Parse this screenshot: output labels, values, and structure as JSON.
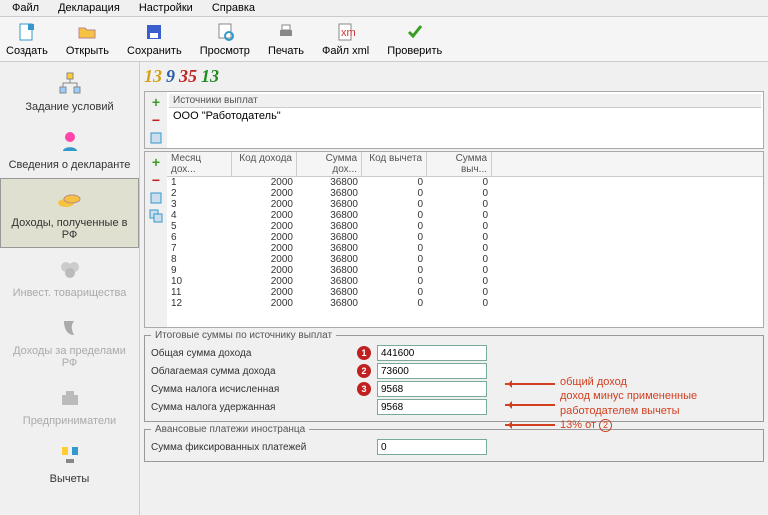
{
  "menu": {
    "file": "Файл",
    "decl": "Декларация",
    "settings": "Настройки",
    "help": "Справка"
  },
  "toolbar": {
    "create": "Создать",
    "open": "Открыть",
    "save": "Сохранить",
    "preview": "Просмотр",
    "print": "Печать",
    "xml": "Файл xml",
    "check": "Проверить"
  },
  "sidebar": {
    "conditions": "Задание условий",
    "declarant": "Сведения о декларанте",
    "income_rf": "Доходы, полученные в РФ",
    "invest": "Инвест. товарищества",
    "income_abroad": "Доходы за пределами РФ",
    "entrepreneurs": "Предприниматели",
    "deductions": "Вычеты"
  },
  "tabs": {
    "t1": "13",
    "t2": "9",
    "t3": "35",
    "t4": "13"
  },
  "sources": {
    "title": "Источники выплат",
    "item1": "ООО \"Работодатель\""
  },
  "grid": {
    "headers": [
      "Месяц дох...",
      "Код дохода",
      "Сумма дох...",
      "Код вычета",
      "Сумма выч..."
    ],
    "rows": [
      [
        "1",
        "2000",
        "36800",
        "0",
        "0"
      ],
      [
        "2",
        "2000",
        "36800",
        "0",
        "0"
      ],
      [
        "3",
        "2000",
        "36800",
        "0",
        "0"
      ],
      [
        "4",
        "2000",
        "36800",
        "0",
        "0"
      ],
      [
        "5",
        "2000",
        "36800",
        "0",
        "0"
      ],
      [
        "6",
        "2000",
        "36800",
        "0",
        "0"
      ],
      [
        "7",
        "2000",
        "36800",
        "0",
        "0"
      ],
      [
        "8",
        "2000",
        "36800",
        "0",
        "0"
      ],
      [
        "9",
        "2000",
        "36800",
        "0",
        "0"
      ],
      [
        "10",
        "2000",
        "36800",
        "0",
        "0"
      ],
      [
        "11",
        "2000",
        "36800",
        "0",
        "0"
      ],
      [
        "12",
        "2000",
        "36800",
        "0",
        "0"
      ]
    ]
  },
  "totals": {
    "legend": "Итоговые суммы по источнику выплат",
    "total_income_label": "Общая сумма дохода",
    "total_income": "441600",
    "taxable_label": "Облагаемая сумма дохода",
    "taxable": "73600",
    "tax_calc_label": "Сумма налога исчисленная",
    "tax_calc": "9568",
    "tax_withheld_label": "Сумма налога удержанная",
    "tax_withheld": "9568",
    "b1": "1",
    "b2": "2",
    "b3": "3"
  },
  "advance": {
    "legend": "Авансовые платежи иностранца",
    "fixed_label": "Сумма фиксированных платежей",
    "fixed": "0"
  },
  "ann": {
    "a1": "общий доход",
    "a2": "доход минус примененные",
    "a3": "работодателем вычеты",
    "a4_prefix": "13% от ",
    "a4_num": "2"
  }
}
